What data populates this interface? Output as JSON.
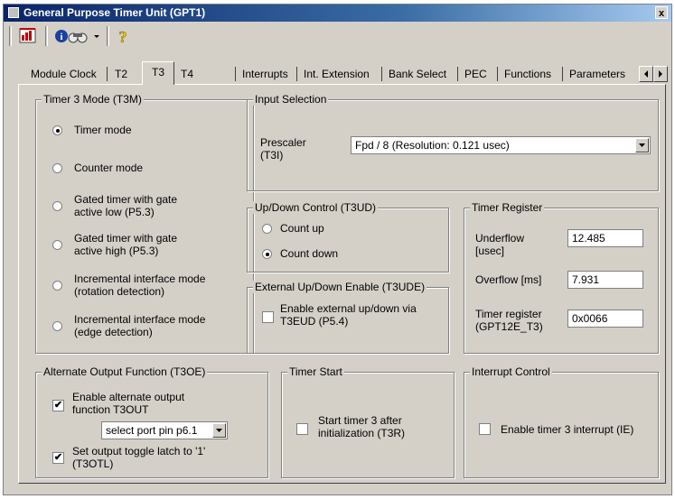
{
  "window": {
    "title": "General Purpose Timer Unit (GPT1)",
    "close_label": "x"
  },
  "tabs": [
    {
      "label": "Module Clock"
    },
    {
      "label": "T2"
    },
    {
      "label": "T3"
    },
    {
      "label": "T4"
    },
    {
      "label": "Interrupts"
    },
    {
      "label": "Int. Extension"
    },
    {
      "label": "Bank Select"
    },
    {
      "label": "PEC"
    },
    {
      "label": "Functions"
    },
    {
      "label": "Parameters"
    }
  ],
  "selected_tab": "T3",
  "t3m": {
    "title": "Timer 3 Mode (T3M)",
    "options": [
      {
        "line1": "Timer mode",
        "line2": ""
      },
      {
        "line1": "Counter mode",
        "line2": ""
      },
      {
        "line1": "Gated timer with gate",
        "line2": "active low (P5.3)"
      },
      {
        "line1": "Gated timer with gate",
        "line2": "active high (P5.3)"
      },
      {
        "line1": "Incremental interface mode",
        "line2": "(rotation detection)"
      },
      {
        "line1": "Incremental interface mode",
        "line2": "(edge detection)"
      }
    ],
    "selected": "Timer mode"
  },
  "input_selection": {
    "title": "Input Selection",
    "prescaler_label_1": "Prescaler",
    "prescaler_label_2": "(T3I)",
    "prescaler_value": "Fpd / 8 (Resolution: 0.121 usec)"
  },
  "updown": {
    "title": "Up/Down Control (T3UD)",
    "count_up": "Count up",
    "count_down": "Count down",
    "selected": "Count down"
  },
  "ext_updown": {
    "title": "External Up/Down Enable (T3UDE)",
    "line1": "Enable external up/down via",
    "line2": "T3EUD (P5.4)",
    "checked": false
  },
  "timer_register": {
    "title": "Timer Register",
    "underflow_label_1": "Underflow",
    "underflow_label_2": "[usec]",
    "underflow_value": "12.485",
    "overflow_label": "Overflow [ms]",
    "overflow_value": "7.931",
    "register_label_1": "Timer register",
    "register_label_2": "(GPT12E_T3)",
    "register_value": "0x0066"
  },
  "alt_output": {
    "title": "Alternate Output Function (T3OE)",
    "enable_line1": "Enable alternate output",
    "enable_line2": "function T3OUT",
    "enable_checked": true,
    "port_select": "select port pin p6.1",
    "toggle_line1": "Set output toggle latch to '1'",
    "toggle_line2": "(T3OTL)",
    "toggle_checked": true
  },
  "timer_start": {
    "title": "Timer Start",
    "line1": "Start timer 3 after",
    "line2": "initialization (T3R)",
    "checked": false
  },
  "interrupt_control": {
    "title": "Interrupt Control",
    "label": "Enable timer 3 interrupt (IE)",
    "checked": false
  },
  "icons": [
    "window-icon",
    "chart-icon",
    "info-binoculars-icon",
    "dropdown-arrow-icon",
    "help-question-icon",
    "scroll-left-icon",
    "scroll-right-icon"
  ],
  "colors": {
    "face": "#d4d0c8",
    "title_start": "#0a246a",
    "title_end": "#a6caf0",
    "help_yellow": "#e8c800",
    "chart_red": "#c00000"
  }
}
